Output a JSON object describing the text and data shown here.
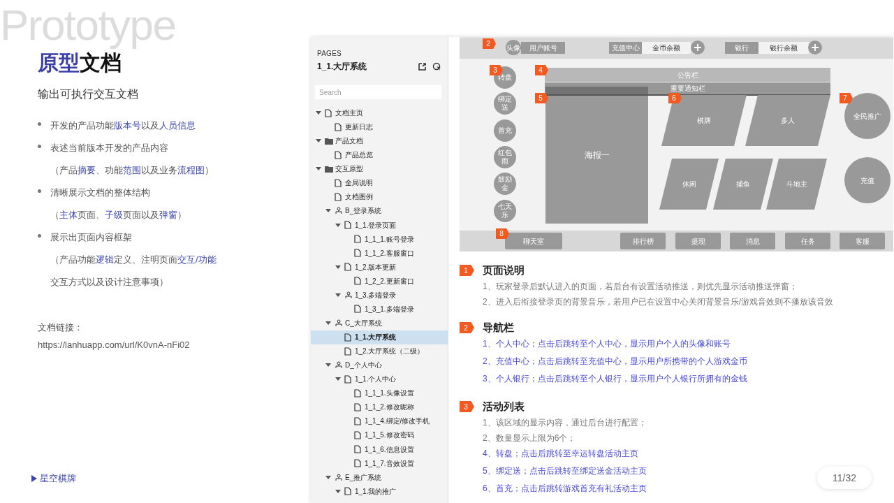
{
  "slide": {
    "backdrop_word": "Prototype",
    "title": [
      {
        "text": "原型",
        "highlight": true
      },
      {
        "text": "文档",
        "highlight": false
      }
    ],
    "subtitle": "输出可执行交互文档",
    "bullets": [
      {
        "lines": [
          [
            {
              "text": "开发的产品功能",
              "highlight": false
            },
            {
              "text": "版本号",
              "highlight": true
            },
            {
              "text": "以及",
              "highlight": false
            },
            {
              "text": "人员信息",
              "highlight": true
            }
          ]
        ]
      },
      {
        "lines": [
          [
            {
              "text": "表述当前版本开发的产品内容",
              "highlight": false
            }
          ],
          [
            {
              "text": "（产品",
              "highlight": false
            },
            {
              "text": "摘要",
              "highlight": true
            },
            {
              "text": "、功能",
              "highlight": false
            },
            {
              "text": "范围",
              "highlight": true
            },
            {
              "text": "以及业务",
              "highlight": false
            },
            {
              "text": "流程图",
              "highlight": true
            },
            {
              "text": "）",
              "highlight": false
            }
          ]
        ]
      },
      {
        "lines": [
          [
            {
              "text": "清晰展示文档的整体结构",
              "highlight": false
            }
          ],
          [
            {
              "text": "（",
              "highlight": false
            },
            {
              "text": "主体",
              "highlight": true
            },
            {
              "text": "页面、",
              "highlight": false
            },
            {
              "text": "子级",
              "highlight": true
            },
            {
              "text": "页面以及",
              "highlight": false
            },
            {
              "text": "弹窗",
              "highlight": true
            },
            {
              "text": "）",
              "highlight": false
            }
          ]
        ]
      },
      {
        "lines": [
          [
            {
              "text": "展示出页面内容框架",
              "highlight": false
            }
          ],
          [
            {
              "text": "（产品功能",
              "highlight": false
            },
            {
              "text": "逻辑",
              "highlight": true
            },
            {
              "text": "定义、注明页面",
              "highlight": false
            },
            {
              "text": "交互/功能",
              "highlight": true
            }
          ],
          [
            {
              "text": "交互方式以及设计注意事项）",
              "highlight": false
            }
          ]
        ]
      }
    ],
    "link_label": "文档链接：",
    "link_url": "https://lanhuapp.com/url/K0vnA-nFi02",
    "footer": "星空棋牌",
    "page_counter": "11/32"
  },
  "viewer": {
    "sidebar": {
      "heading": "PAGES",
      "page_title": "1_1.大厅系统",
      "search": {
        "placeholder": "Search"
      },
      "tree": [
        {
          "label": "文档主页",
          "kind": "page",
          "selected": false,
          "expanded": true,
          "children": [
            {
              "label": "更新日志",
              "kind": "page",
              "selected": false
            }
          ]
        },
        {
          "label": "产品文档",
          "kind": "folder",
          "selected": false,
          "expanded": true,
          "children": [
            {
              "label": "产品总览",
              "kind": "page",
              "selected": false
            }
          ]
        },
        {
          "label": "交互原型",
          "kind": "folder",
          "selected": false,
          "expanded": true,
          "children": [
            {
              "label": "全局说明",
              "kind": "page",
              "selected": false
            },
            {
              "label": "文档图例",
              "kind": "page",
              "selected": false
            },
            {
              "label": "B_登录系统",
              "kind": "flow",
              "selected": false,
              "expanded": true,
              "children": [
                {
                  "label": "1_1.登录页面",
                  "kind": "page",
                  "selected": false,
                  "expanded": true,
                  "children": [
                    {
                      "label": "1_1_1.账号登录",
                      "kind": "page",
                      "selected": false
                    },
                    {
                      "label": "1_1_2.客服窗口",
                      "kind": "page",
                      "selected": false
                    }
                  ]
                },
                {
                  "label": "1_2.版本更新",
                  "kind": "page",
                  "selected": false,
                  "expanded": true,
                  "children": [
                    {
                      "label": "1_2_2.更新窗口",
                      "kind": "page",
                      "selected": false
                    }
                  ]
                },
                {
                  "label": "1_3.多端登录",
                  "kind": "flow",
                  "selected": false,
                  "expanded": true,
                  "children": [
                    {
                      "label": "1_3_1.多端登录",
                      "kind": "page",
                      "selected": false
                    }
                  ]
                }
              ]
            },
            {
              "label": "C_大厅系统",
              "kind": "flow",
              "selected": false,
              "expanded": true,
              "children": [
                {
                  "label": "1_1.大厅系统",
                  "kind": "page",
                  "selected": true
                },
                {
                  "label": "1_2.大厅系统（二级）",
                  "kind": "page",
                  "selected": false
                }
              ]
            },
            {
              "label": "D_个人中心",
              "kind": "flow",
              "selected": false,
              "expanded": true,
              "children": [
                {
                  "label": "1_1.个人中心",
                  "kind": "page",
                  "selected": false,
                  "expanded": true,
                  "children": [
                    {
                      "label": "1_1_1.头像设置",
                      "kind": "page",
                      "selected": false
                    },
                    {
                      "label": "1_1_2.修改昵称",
                      "kind": "page",
                      "selected": false
                    },
                    {
                      "label": "1_1_4.绑定/修改手机",
                      "kind": "page",
                      "selected": false
                    },
                    {
                      "label": "1_1_5.修改密码",
                      "kind": "page",
                      "selected": false
                    },
                    {
                      "label": "1_1_6.信息设置",
                      "kind": "page",
                      "selected": false
                    },
                    {
                      "label": "1_1_7.音效设置",
                      "kind": "page",
                      "selected": false
                    }
                  ]
                }
              ]
            },
            {
              "label": "E_推广系统",
              "kind": "flow",
              "selected": false,
              "expanded": true,
              "children": [
                {
                  "label": "1_1.我的推广",
                  "kind": "page",
                  "selected": false,
                  "expanded": true
                }
              ]
            }
          ]
        }
      ]
    },
    "wireframe": {
      "markers": [
        "2",
        "3",
        "4",
        "5",
        "6",
        "7",
        "8"
      ],
      "top_bar": {
        "avatar": "头像",
        "account": "用户账号",
        "recharge_label": "充值中心",
        "coin_balance": "金币余额",
        "bank_label": "银行",
        "bank_balance": "银行余额"
      },
      "activities": [
        "转盘",
        "绑定送",
        "首充",
        "红包雨",
        "鼓励金",
        "七天乐"
      ],
      "notice": "公告栏",
      "important_notice": "重要通知栏",
      "poster": "海报一",
      "games": [
        "棋牌",
        "多人",
        "休闲",
        "捕鱼",
        "斗地主"
      ],
      "side_buttons": [
        "全民推广",
        "充值"
      ],
      "bottom_bar": [
        "聊天室",
        "排行榜",
        "提现",
        "消息",
        "任务",
        "客服"
      ]
    },
    "notes": [
      {
        "number": "1",
        "title": "页面说明",
        "lines": [
          {
            "text": "1、玩家登录后默认进入的页面，若后台有设置活动推送，则优先显示活动推送弹窗；",
            "kind": "plain"
          },
          {
            "text": "2、进入后衔接登录页的背景音乐，若用户已在设置中心关闭背景音乐/游戏音效则不播放该音效",
            "kind": "plain"
          }
        ]
      },
      {
        "number": "2",
        "title": "导航栏",
        "lines": [
          {
            "text": "1、个人中心；点击后跳转至个人中心，显示用户个人的头像和账号",
            "kind": "link"
          },
          {
            "text": "2、充值中心；点击后跳转至充值中心，显示用户所携带的个人游戏金币",
            "kind": "link"
          },
          {
            "text": "3、个人银行；点击后跳转至个人银行，显示用户个人银行所拥有的金钱",
            "kind": "link"
          }
        ]
      },
      {
        "number": "3",
        "title": "活动列表",
        "lines": [
          {
            "text": "1、该区域的显示内容，通过后台进行配置；",
            "kind": "plain"
          },
          {
            "text": "2、数量显示上限为6个；",
            "kind": "plain"
          },
          {
            "text": "4、转盘；点击后跳转至幸运转盘活动主页",
            "kind": "link"
          },
          {
            "text": "5、绑定送；点击后跳转至绑定送金活动主页",
            "kind": "link"
          },
          {
            "text": "6、首充；点击后跳转游戏首充有礼活动主页",
            "kind": "link"
          }
        ]
      }
    ]
  }
}
